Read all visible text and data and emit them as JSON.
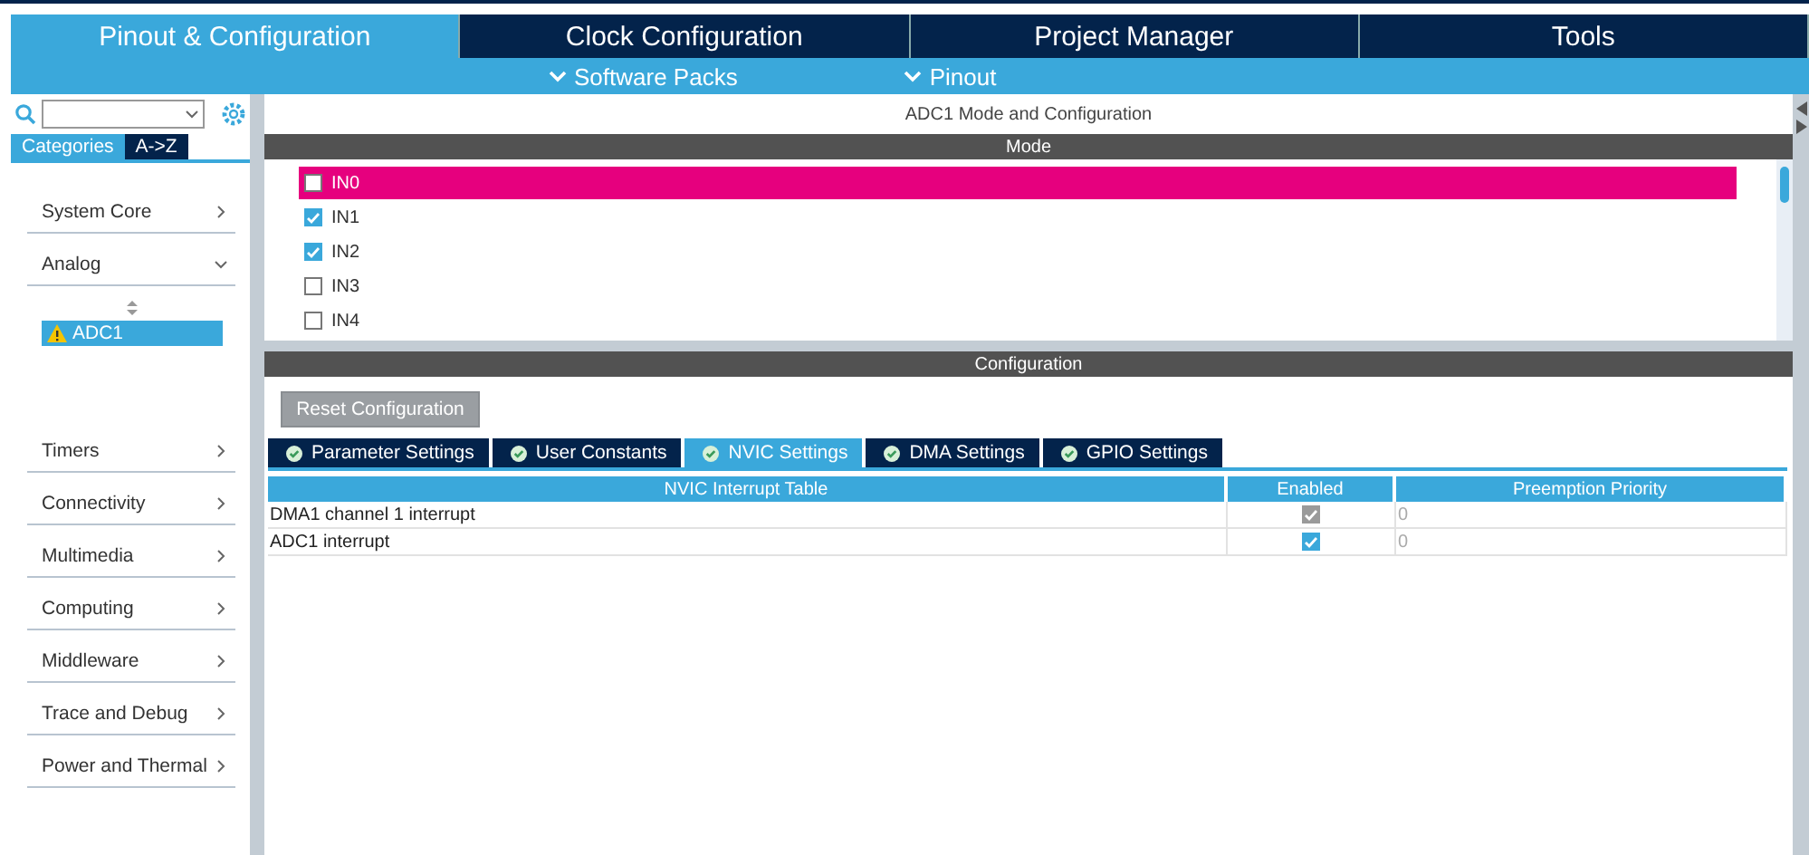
{
  "main_tabs": [
    {
      "label": "Pinout & Configuration",
      "selected": true
    },
    {
      "label": "Clock Configuration",
      "selected": false
    },
    {
      "label": "Project Manager",
      "selected": false
    },
    {
      "label": "Tools",
      "selected": false
    }
  ],
  "sub_menu": [
    "Software Packs",
    "Pinout"
  ],
  "sidebar": {
    "tabs": [
      {
        "label": "Categories",
        "selected": true
      },
      {
        "label": "A->Z",
        "selected": false
      }
    ],
    "items": [
      {
        "label": "System Core",
        "expanded": false
      },
      {
        "label": "Analog",
        "expanded": true,
        "children": [
          {
            "label": "ADC1",
            "warning": true,
            "selected": true
          }
        ]
      },
      {
        "label": "Timers",
        "expanded": false
      },
      {
        "label": "Connectivity",
        "expanded": false
      },
      {
        "label": "Multimedia",
        "expanded": false
      },
      {
        "label": "Computing",
        "expanded": false
      },
      {
        "label": "Middleware",
        "expanded": false
      },
      {
        "label": "Trace and Debug",
        "expanded": false
      },
      {
        "label": "Power and Thermal",
        "expanded": false
      }
    ]
  },
  "panel": {
    "title": "ADC1 Mode and Configuration",
    "mode": {
      "header": "Mode",
      "channels": [
        {
          "label": "IN0",
          "checked": false,
          "selected": true
        },
        {
          "label": "IN1",
          "checked": true,
          "selected": false
        },
        {
          "label": "IN2",
          "checked": true,
          "selected": false
        },
        {
          "label": "IN3",
          "checked": false,
          "selected": false
        },
        {
          "label": "IN4",
          "checked": false,
          "selected": false
        }
      ]
    },
    "configuration": {
      "header": "Configuration",
      "reset_button": "Reset Configuration",
      "tabs": [
        {
          "label": "Parameter Settings",
          "selected": false
        },
        {
          "label": "User Constants",
          "selected": false
        },
        {
          "label": "NVIC Settings",
          "selected": true
        },
        {
          "label": "DMA Settings",
          "selected": false
        },
        {
          "label": "GPIO Settings",
          "selected": false
        }
      ],
      "table": {
        "columns": [
          "NVIC Interrupt Table",
          "Enabled",
          "Preemption Priority"
        ],
        "rows": [
          {
            "name": "DMA1 channel 1 interrupt",
            "enabled": true,
            "disabled": true,
            "priority": "0"
          },
          {
            "name": "ADC1 interrupt",
            "enabled": true,
            "disabled": false,
            "priority": "0"
          }
        ]
      }
    }
  }
}
